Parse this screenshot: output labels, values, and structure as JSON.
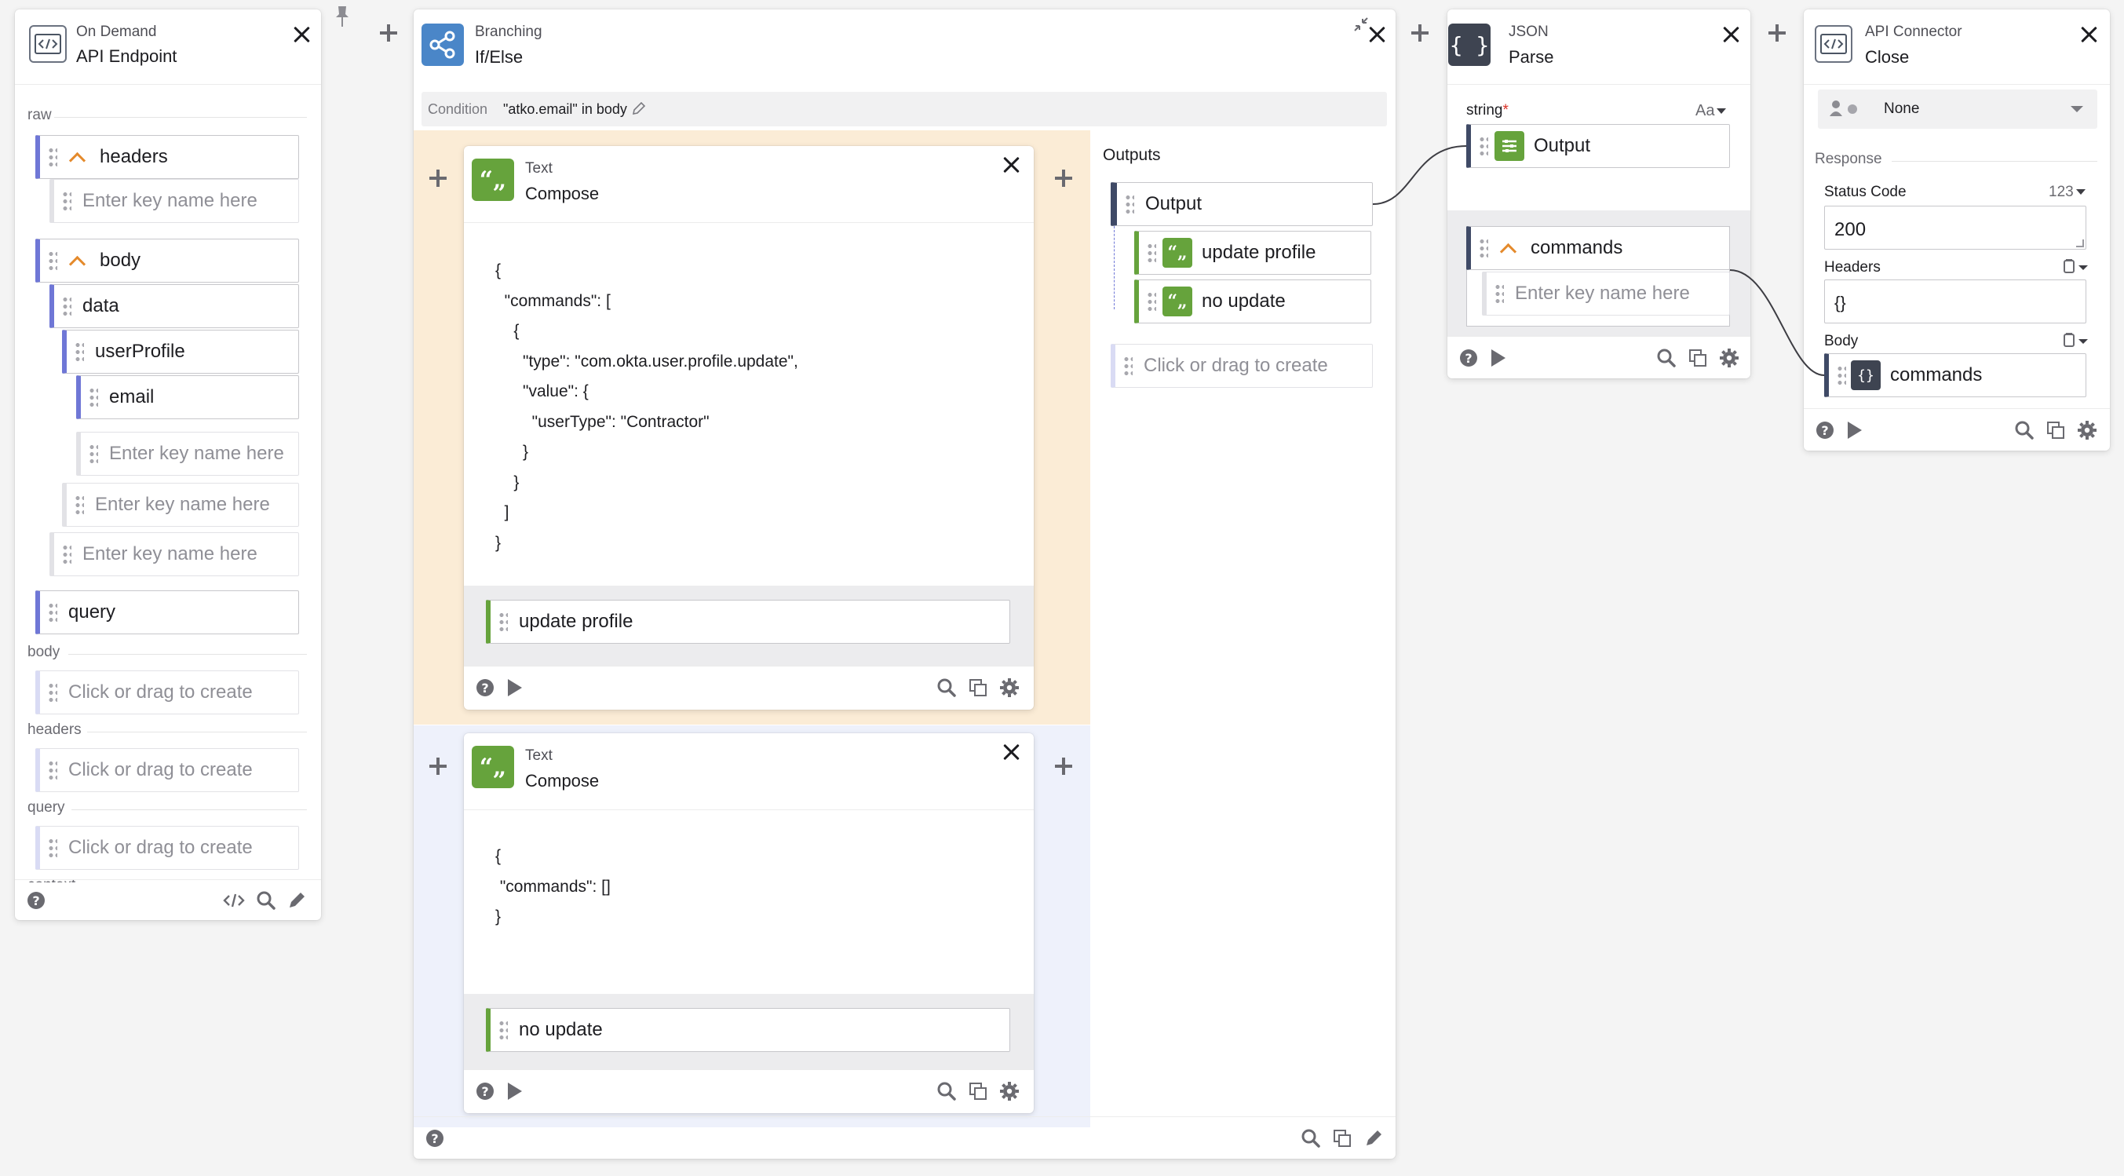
{
  "colors": {
    "canvas_bg": "#f4f4f4",
    "branch_true_bg": "#fbecd6",
    "branch_false_bg": "#eef1fb",
    "field_accent": "#6f77d6",
    "text_green": "#66a33c",
    "json_dark": "#3e4451",
    "caret_orange": "#e48a2c"
  },
  "endpoint": {
    "app": "On Demand",
    "action": "API Endpoint",
    "raw_label": "raw",
    "headers_label": "headers",
    "body_label": "body",
    "data_label": "data",
    "user_profile_label": "userProfile",
    "email_label": "email",
    "query_label": "query",
    "key_placeholder": "Enter key name here",
    "section_body": "body",
    "section_headers": "headers",
    "section_query": "query",
    "section_context": "context",
    "create_placeholder": "Click or drag to create"
  },
  "branching": {
    "app": "Branching",
    "action": "If/Else",
    "condition_label": "Condition",
    "condition_value": "\"atko.email\" in body",
    "outputs_label": "Outputs",
    "output_main": "Output",
    "output_update": "update profile",
    "output_noupdate": "no update",
    "create_placeholder": "Click or drag to create"
  },
  "compose_true": {
    "app": "Text",
    "action": "Compose",
    "lines": [
      "{",
      "  \"commands\": [",
      "    {",
      "      \"type\": \"com.okta.user.profile.update\",",
      "      \"value\": {",
      "        \"userType\": \"Contractor\"",
      "      }",
      "    }",
      "  ]",
      "}"
    ],
    "output_label": "update profile"
  },
  "compose_false": {
    "app": "Text",
    "action": "Compose",
    "lines": [
      "{",
      " \"commands\": []",
      "}"
    ],
    "output_label": "no update"
  },
  "json_parse": {
    "app": "JSON",
    "action": "Parse",
    "string_label": "string",
    "required_mark": "*",
    "format_label": "Aa",
    "input_label": "Output",
    "commands_label": "commands",
    "key_placeholder": "Enter key name here"
  },
  "api_connector": {
    "app": "API Connector",
    "action": "Close",
    "connection_value": "None",
    "response_label": "Response",
    "status_code_label": "Status Code",
    "status_type": "123",
    "status_code_value": "200",
    "headers_label": "Headers",
    "headers_value": "{}",
    "body_label": "Body",
    "body_value": "commands"
  }
}
